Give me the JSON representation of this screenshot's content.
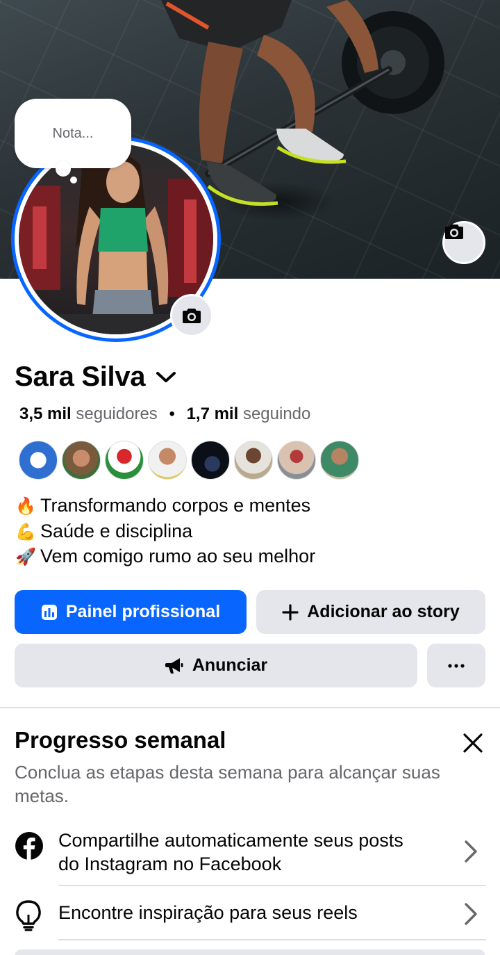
{
  "profile": {
    "name": "Sara Silva",
    "followers_count": "3,5 mil",
    "followers_label": "seguidores",
    "following_count": "1,7 mil",
    "following_label": "seguindo",
    "separator": "•"
  },
  "note": {
    "placeholder": "Nota..."
  },
  "icons": {
    "cover_camera": "camera-icon",
    "avatar_camera": "camera-icon",
    "name_dropdown": "chevron-down-icon",
    "dashboard": "bar-chart-icon",
    "add_story": "plus-icon",
    "advertise": "megaphone-icon",
    "more": "ellipsis-icon",
    "close": "close-icon",
    "facebook": "facebook-logo-icon",
    "lightbulb": "lightbulb-icon",
    "arrow": "chevron-right-icon"
  },
  "bio": [
    {
      "emoji": "🔥",
      "text": "Transformando corpos e mentes"
    },
    {
      "emoji": "💪",
      "text": "Saúde e disciplina"
    },
    {
      "emoji": "🚀",
      "text": "Vem comigo rumo ao seu melhor"
    }
  ],
  "actions": {
    "dashboard_label": "Painel profissional",
    "add_story_label": "Adicionar ao story",
    "advertise_label": "Anunciar"
  },
  "weekly_progress": {
    "title": "Progresso semanal",
    "subtitle": "Conclua as etapas desta semana para alcançar suas metas.",
    "tasks": [
      {
        "line1": "Compartilhe automaticamente seus posts",
        "line2": "do Instagram no Facebook"
      },
      {
        "line1": "Encontre inspiração para seus reels"
      }
    ]
  },
  "colors": {
    "brand_blue": "#0866ff",
    "secondary_button": "#e4e6eb",
    "text_primary": "#050505",
    "text_secondary": "#65676b",
    "divider": "#dddfe2"
  }
}
